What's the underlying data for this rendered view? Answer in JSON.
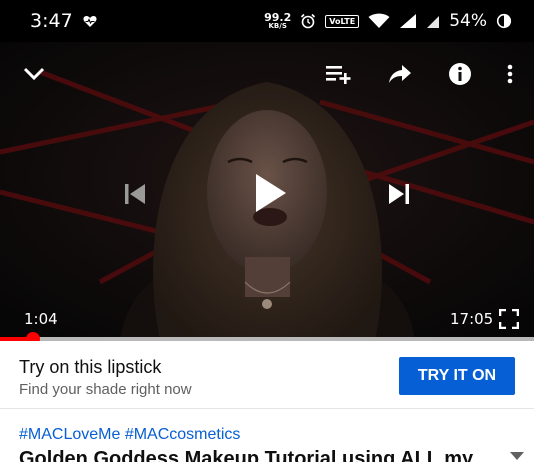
{
  "status_bar": {
    "time": "3:47",
    "net_speed_value": "99.2",
    "net_speed_unit": "KB/S",
    "volte": "VoLTE",
    "battery": "54%"
  },
  "player": {
    "current_time": "1:04",
    "duration": "17:05",
    "progress_fraction": 0.0624
  },
  "ad": {
    "title": "Try on this lipstick",
    "subtitle": "Find your shade right now",
    "cta": "TRY IT ON"
  },
  "video": {
    "hashtags": "#MACLoveMe #MACcosmetics",
    "title": "Golden Goddess Makeup Tutorial using ALL my"
  },
  "colors": {
    "accent_red": "#ff0000",
    "link_blue": "#065fd4"
  }
}
